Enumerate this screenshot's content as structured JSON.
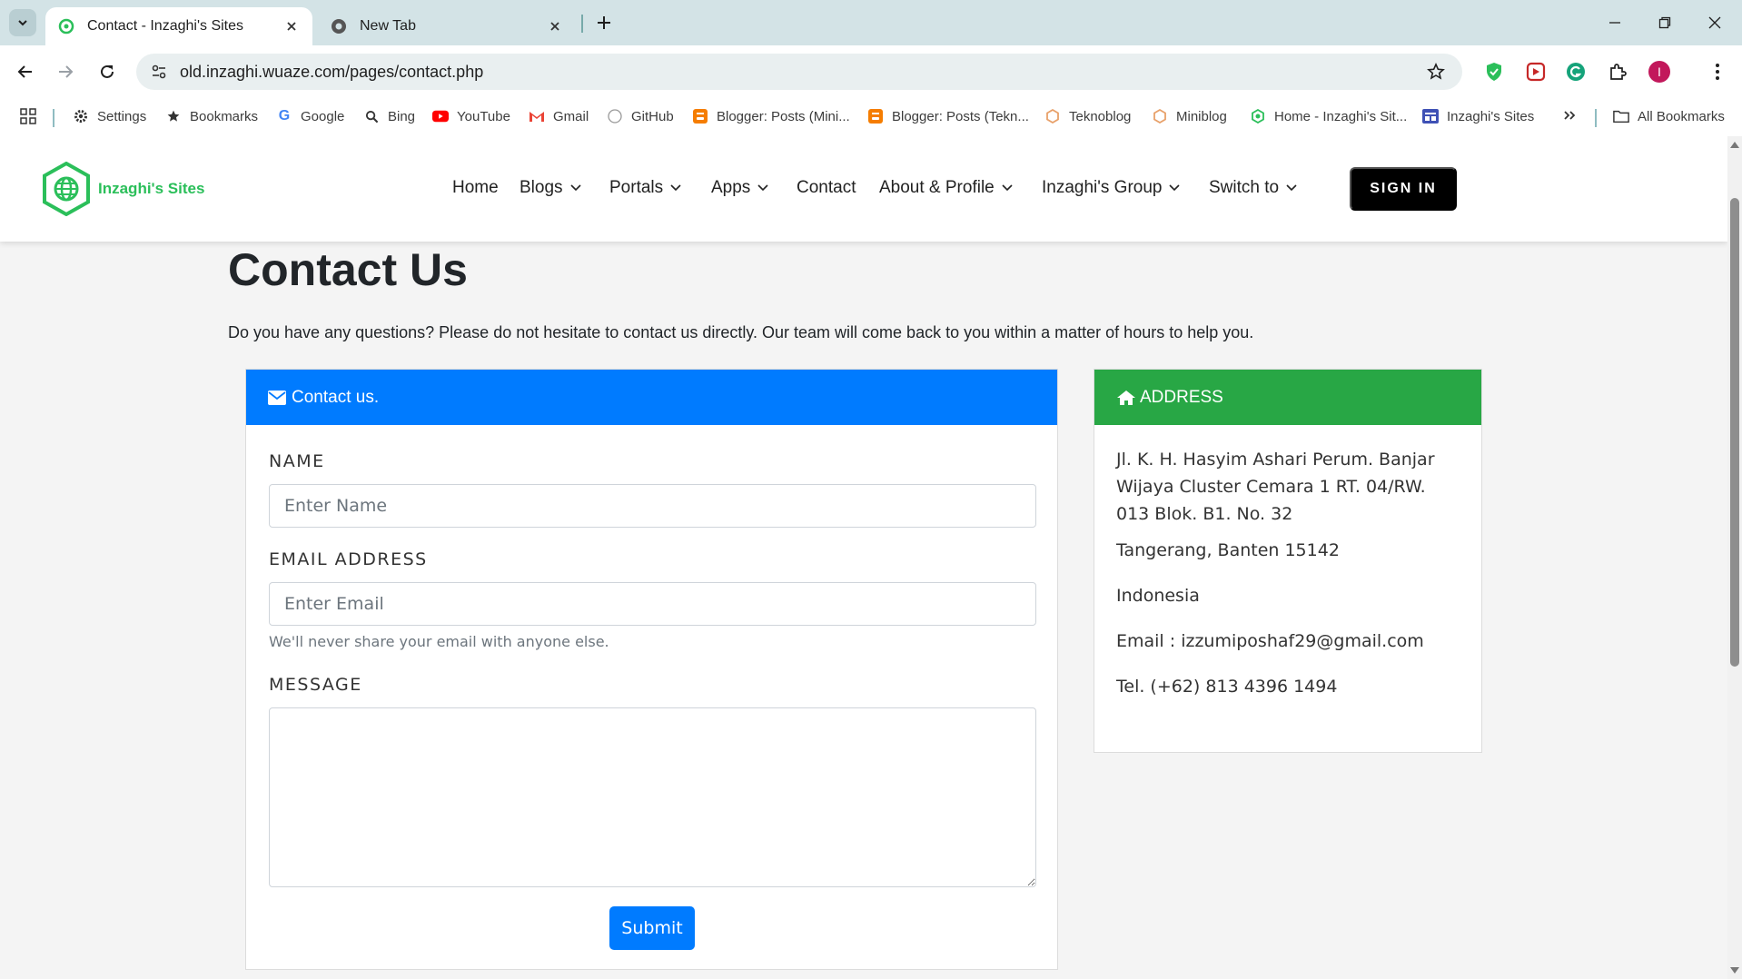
{
  "browser": {
    "tabs": [
      {
        "title": "Contact - Inzaghi's Sites",
        "active": true
      },
      {
        "title": "New Tab",
        "active": false
      }
    ],
    "url": "old.inzaghi.wuaze.com/pages/contact.php",
    "profile_initial": "I",
    "bookmarks": [
      {
        "label": "Settings",
        "icon": "gear-icon"
      },
      {
        "label": "Bookmarks",
        "icon": "star-icon"
      },
      {
        "label": "Google",
        "icon": "google-icon"
      },
      {
        "label": "Bing",
        "icon": "search-icon"
      },
      {
        "label": "YouTube",
        "icon": "youtube-icon"
      },
      {
        "label": "Gmail",
        "icon": "gmail-icon"
      },
      {
        "label": "GitHub",
        "icon": "github-icon"
      },
      {
        "label": "Blogger: Posts (Mini...",
        "icon": "blogger-icon"
      },
      {
        "label": "Blogger: Posts (Tekn...",
        "icon": "blogger-icon"
      },
      {
        "label": "Teknoblog",
        "icon": "hexagon-icon"
      },
      {
        "label": "Miniblog",
        "icon": "hexagon-icon"
      },
      {
        "label": "Home - Inzaghi's Sit...",
        "icon": "site-icon"
      },
      {
        "label": "Inzaghi's Sites",
        "icon": "site-icon"
      }
    ],
    "all_bookmarks_label": "All Bookmarks"
  },
  "site": {
    "logo_text": "Inzaghi's Sites",
    "nav": [
      {
        "label": "Home",
        "dropdown": false
      },
      {
        "label": "Blogs",
        "dropdown": true
      },
      {
        "label": "Portals",
        "dropdown": true
      },
      {
        "label": "Apps",
        "dropdown": true
      },
      {
        "label": "Contact",
        "dropdown": false
      },
      {
        "label": "About & Profile",
        "dropdown": true
      },
      {
        "label": "Inzaghi's Group",
        "dropdown": true
      },
      {
        "label": "Switch to",
        "dropdown": true
      }
    ],
    "signin_label": "SIGN IN"
  },
  "page": {
    "title": "Contact Us",
    "intro": "Do you have any questions? Please do not hesitate to contact us directly. Our team will come back to you within a matter of hours to help you."
  },
  "contact_form": {
    "header": "Contact us.",
    "name_label": "NAME",
    "name_placeholder": "Enter Name",
    "email_label": "EMAIL ADDRESS",
    "email_placeholder": "Enter Email",
    "email_help": "We'll never share your email with anyone else.",
    "message_label": "MESSAGE",
    "submit_label": "Submit"
  },
  "address": {
    "header": "ADDRESS",
    "street": "Jl. K. H. Hasyim Ashari Perum. Banjar Wijaya Cluster Cemara 1 RT. 04/RW. 013 Blok. B1. No. 32",
    "city": "Tangerang, Banten 15142",
    "country": "Indonesia",
    "email": "Email : izzumiposhaf29@gmail.com",
    "phone": "Tel. (+62) 813 4396 1494"
  },
  "colors": {
    "contact_header": "#007bff",
    "address_header": "#28a745",
    "logo_green": "#2bbf5a"
  }
}
